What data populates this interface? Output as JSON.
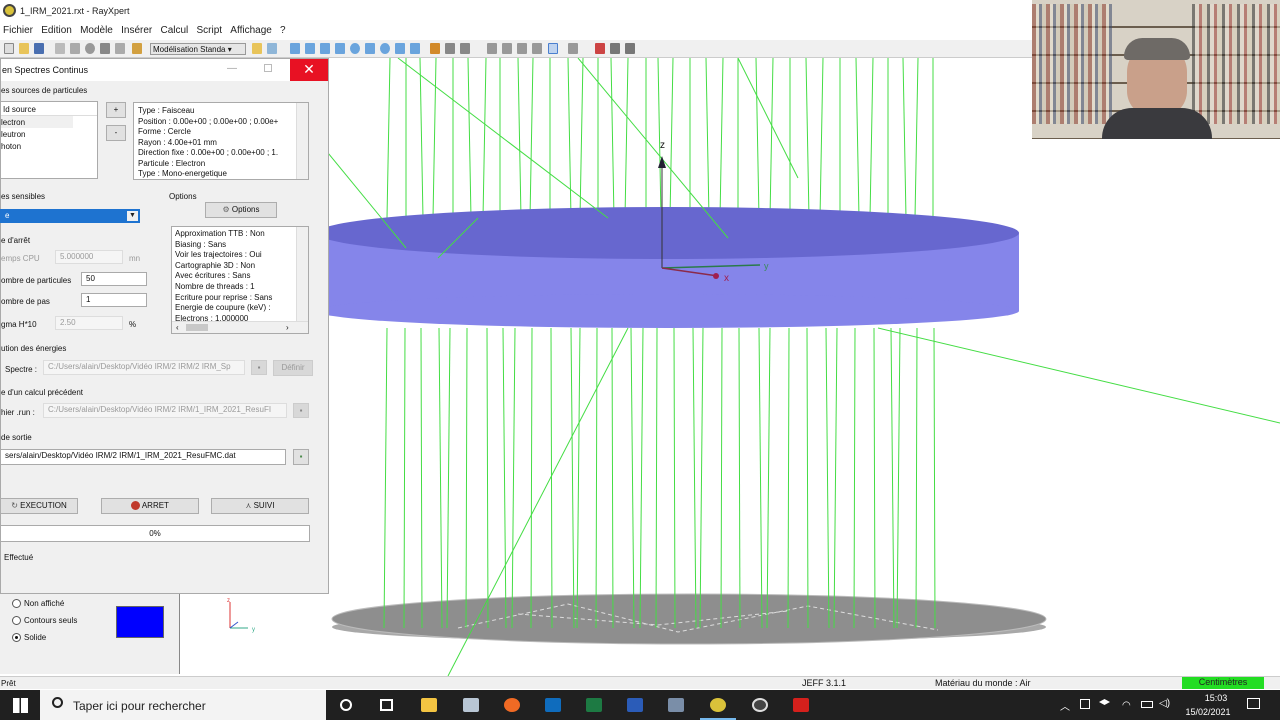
{
  "app": {
    "title": "1_IRM_2021.rxt - RayXpert",
    "menu": [
      "Fichier",
      "Edition",
      "Modèle",
      "Insérer",
      "Calcul",
      "Script",
      "Affichage",
      "?"
    ],
    "mode": "Modélisation Standa"
  },
  "dialog": {
    "title": "en Spectres Continus",
    "close_glyph": "✕",
    "sources_group": "es sources de particules",
    "sources_header": "Id source",
    "sources": [
      "lectron",
      "leutron",
      "hoton"
    ],
    "add_label": "+",
    "remove_label": "-",
    "source_details": [
      "Type : Faisceau",
      "Position : 0.00e+00 ; 0.00e+00 ; 0.00e+",
      "Forme : Cercle",
      "Rayon : 4.00e+01 mm",
      "Direction fixe : 0.00e+00 ; 0.00e+00 ; 1.",
      "Particule : Electron",
      "Type : Mono-energetique"
    ],
    "sensitive_group": "es sensibles",
    "sensitive_selected": "e",
    "options_group": "Options",
    "options_button": "Options",
    "options_list": [
      "Approximation TTB : Non",
      "Biasing : Sans",
      "Voir les trajectoires : Oui",
      "Cartographie 3D : Non",
      "Avec écritures : Sans",
      "Nombre de threads : 1",
      "Ecriture pour reprise : Sans",
      "Energie de coupure (keV) :",
      "   Electrons : 1.000000"
    ],
    "stop_group": "e d'arrêt",
    "cpu_label": "emps CPU",
    "cpu_value": "5.000000",
    "cpu_unit": "mn",
    "particles_label": "ombre de particules",
    "particles_value": "50",
    "steps_label": "ombre de pas",
    "steps_value": "1",
    "sigma_label": "gma H*10",
    "sigma_value": "2.50",
    "sigma_unit": "%",
    "energy_group": "ution des énergies",
    "spectre_label": "Spectre :",
    "spectre_value": "C:/Users/alain/Desktop/Vidéo IRM/2 IRM/2 IRM_Sp",
    "define_label": "Définir",
    "prev_group": "e d'un calcul précédent",
    "run_label": "hier .run :",
    "run_value": "C:/Users/alain/Desktop/Vidéo IRM/2 IRM/1_IRM_2021_ResuFI",
    "output_group": "de sortie",
    "output_value": "sers/alain/Desktop/Vidéo IRM/2 IRM/1_IRM_2021_ResuFMC.dat",
    "exec_label": "EXECUTION",
    "stop_label": "ARRET",
    "follow_label": "SUIVI",
    "progress": 0,
    "progress_label": "0%",
    "status": "Effectué"
  },
  "lower_panel": {
    "options": [
      "Non affiché",
      "Contours seuls",
      "Solide"
    ],
    "selected": "Solide",
    "color": "#0000ff"
  },
  "viewport": {
    "axis_z": "z",
    "axis_x": "x",
    "axis_y": "y",
    "mini_z": "z",
    "mini_y": "y",
    "cylinder_color": "#7f7fe8",
    "track_color": "#44dd44",
    "disk_color": "#9a9a9a"
  },
  "statusbar": {
    "left": "Prêt",
    "library": "JEFF 3.1.1",
    "world_material": "Matériau du monde : Air",
    "units": "Centimètres"
  },
  "taskbar": {
    "search_placeholder": "Taper ici pour rechercher",
    "time": "15:03",
    "date": "15/02/2021"
  }
}
